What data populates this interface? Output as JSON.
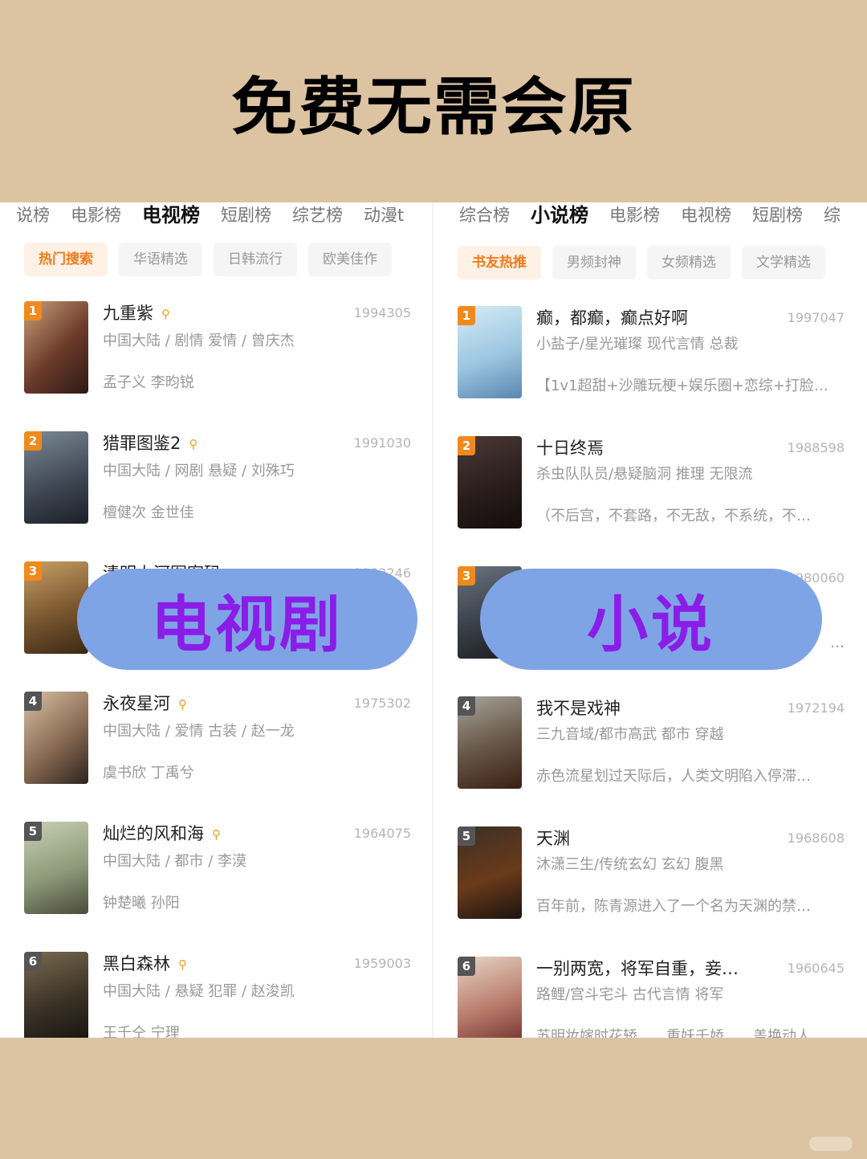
{
  "headline": "免费无需会原",
  "left_panel": {
    "tabs": [
      "说榜",
      "电影榜",
      "电视榜",
      "短剧榜",
      "综艺榜",
      "动漫t"
    ],
    "active_tab": 2,
    "chips": [
      "热门搜索",
      "华语精选",
      "日韩流行",
      "欧美佳作"
    ],
    "active_chip": 0,
    "items": [
      {
        "rank": "1",
        "title": "九重紫",
        "count": "1994305",
        "meta": "中国大陆 / 剧情 爱情 / 曾庆杰",
        "desc": "孟子义 李昀锐"
      },
      {
        "rank": "2",
        "title": "猎罪图鉴2",
        "count": "1991030",
        "meta": "中国大陆 / 网剧 悬疑 / 刘殊巧",
        "desc": "檀健次 金世佳"
      },
      {
        "rank": "3",
        "title": "清明上河图密码",
        "count": "1983246",
        "meta": "",
        "desc": ""
      },
      {
        "rank": "4",
        "title": "永夜星河",
        "count": "1975302",
        "meta": "中国大陆 / 爱情 古装 / 赵一龙",
        "desc": "虞书欣 丁禹兮"
      },
      {
        "rank": "5",
        "title": "灿烂的风和海",
        "count": "1964075",
        "meta": "中国大陆 / 都市 / 李漠",
        "desc": "钟楚曦 孙阳"
      },
      {
        "rank": "6",
        "title": "黑白森林",
        "count": "1959003",
        "meta": "中国大陆 / 悬疑 犯罪 / 赵浚凯",
        "desc": "王千仝 宁理"
      }
    ]
  },
  "right_panel": {
    "tabs": [
      "综合榜",
      "小说榜",
      "电影榜",
      "电视榜",
      "短剧榜",
      "综"
    ],
    "active_tab": 1,
    "chips": [
      "书友热推",
      "男频封神",
      "女频精选",
      "文学精选"
    ],
    "active_chip": 0,
    "items": [
      {
        "rank": "1",
        "title": "癫，都癫，癫点好啊",
        "count": "1997047",
        "meta": "小盐子/星光璀璨 现代言情 总裁",
        "desc": "【1v1超甜+沙雕玩梗+娱乐圈+恋综+打脸…"
      },
      {
        "rank": "2",
        "title": "十日终焉",
        "count": "1988598",
        "meta": "杀虫队队员/悬疑脑洞 推理 无限流",
        "desc": "（不后宫，不套路，不无敌，不系统，不…"
      },
      {
        "rank": "3",
        "title": "",
        "count": "1980060",
        "meta": "",
        "desc": "…"
      },
      {
        "rank": "4",
        "title": "我不是戏神",
        "count": "1972194",
        "meta": "三九音域/都市高武 都市 穿越",
        "desc": "赤色流星划过天际后，人类文明陷入停滞…"
      },
      {
        "rank": "5",
        "title": "天渊",
        "count": "1968608",
        "meta": "沐潇三生/传统玄幻 玄幻 腹黑",
        "desc": "百年前，陈青源进入了一个名为天渊的禁…"
      },
      {
        "rank": "6",
        "title": "一别两宽，将军自重，妾…",
        "count": "1960645",
        "meta": "路鲤/宫斗宅斗 古代言情 将军",
        "desc": "苏明妆嫁时花轿，…重妖千娇…，盖换动人"
      }
    ]
  },
  "overlays": {
    "tv_label": "电视剧",
    "novel_label": "小说"
  },
  "icons": {
    "search": "search-icon"
  },
  "colors": {
    "background": "#dcc3a2",
    "accent_orange": "#f07a1a",
    "pill_bg": "#7fa4e6",
    "pill_text": "#8a1de8"
  }
}
